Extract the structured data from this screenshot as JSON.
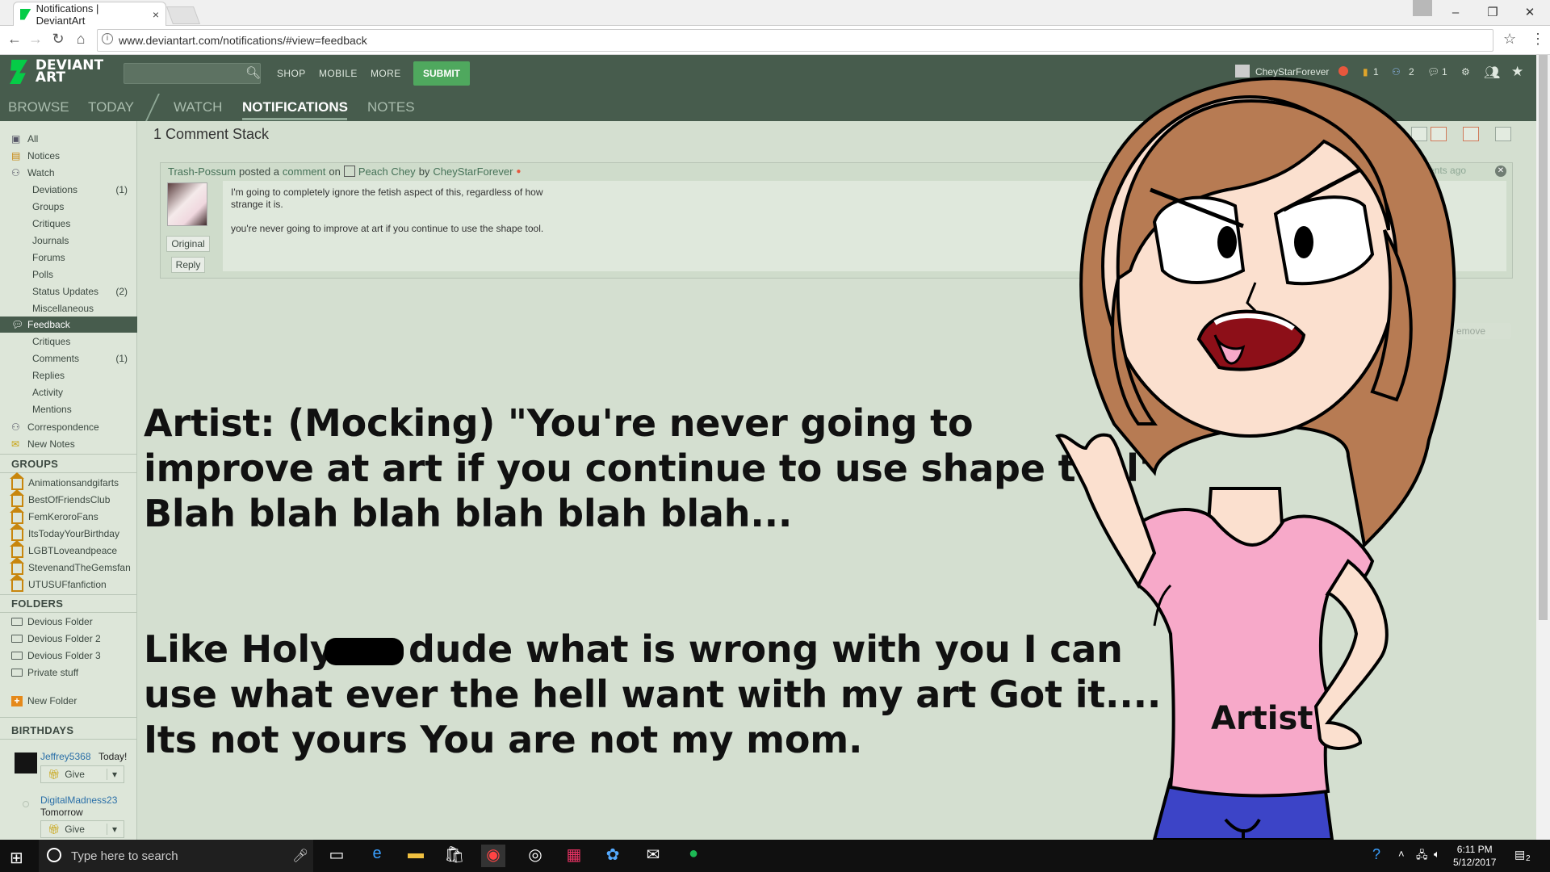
{
  "browser": {
    "tab_title": "Notifications | DeviantArt",
    "tab_close": "×",
    "url": "www.deviantart.com/notifications/#view=feedback",
    "window_controls": [
      "–",
      "❐",
      "✕"
    ],
    "nav_icons": [
      "back-icon",
      "forward-icon",
      "reload-icon",
      "home-icon"
    ]
  },
  "da_header": {
    "logo_line1": "DEVIANT",
    "logo_line2": "ART",
    "nav": [
      "SHOP",
      "MOBILE",
      "MORE"
    ],
    "submit_label": "SUBMIT",
    "username": "CheyStarForever",
    "counts": [
      "1",
      "2",
      "1"
    ]
  },
  "subnav": {
    "items": [
      "BROWSE",
      "TODAY",
      "WATCH",
      "NOTIFICATIONS",
      "NOTES"
    ],
    "active": "NOTIFICATIONS"
  },
  "sidebar": {
    "top": [
      {
        "label": "All",
        "icon": "all-icon"
      },
      {
        "label": "Notices",
        "icon": "notices-icon"
      },
      {
        "label": "Watch",
        "icon": "watch-icon"
      }
    ],
    "watch_sub": [
      {
        "label": "Deviations",
        "count": "(1)"
      },
      {
        "label": "Groups",
        "count": ""
      },
      {
        "label": "Critiques",
        "count": ""
      },
      {
        "label": "Journals",
        "count": ""
      },
      {
        "label": "Forums",
        "count": ""
      },
      {
        "label": "Polls",
        "count": ""
      },
      {
        "label": "Status Updates",
        "count": "(2)"
      },
      {
        "label": "Miscellaneous",
        "count": ""
      }
    ],
    "feedback": "Feedback",
    "feedback_sub": [
      {
        "label": "Critiques",
        "count": ""
      },
      {
        "label": "Comments",
        "count": "(1)"
      },
      {
        "label": "Replies",
        "count": ""
      },
      {
        "label": "Activity",
        "count": ""
      },
      {
        "label": "Mentions",
        "count": ""
      }
    ],
    "correspondence": "Correspondence",
    "new_notes": "New Notes",
    "groups_heading": "GROUPS",
    "groups": [
      "Animationsandgifarts",
      "BestOfFriendsClub",
      "FemKeroroFans",
      "ItsTodayYourBirthday",
      "LGBTLoveandpeace",
      "StevenandTheGemsfan",
      "UTUSUFfanfiction"
    ],
    "folders_heading": "FOLDERS",
    "folders": [
      "Devious Folder",
      "Devious Folder 2",
      "Devious Folder 3",
      "Private stuff"
    ],
    "new_folder": "New Folder",
    "birthdays_heading": "BIRTHDAYS",
    "birthdays": [
      {
        "name": "Jeffrey5368",
        "when": "Today!",
        "give": "Give"
      },
      {
        "name": "DigitalMadness23",
        "when": "Tomorrow",
        "give": "Give"
      }
    ]
  },
  "main": {
    "stack_title": "1 Comment Stack",
    "comment": {
      "author": "Trash-Possum",
      "posted_a": "posted a",
      "comment_link": "comment",
      "on": "on",
      "deviation": "Peach Chey",
      "by": "by",
      "owner": "CheyStarForever",
      "time": "ents ago",
      "text1": "I'm going to completely ignore the fetish aspect of this, regardless of how strange it is.",
      "text2": "you're never going to improve at art if you continue to use the shape tool.",
      "original_label": "Original",
      "reply_label": "Reply",
      "remove_label": "emove"
    }
  },
  "overlay": {
    "lines1": [
      "Artist: (Mocking) \"You're never going to",
      "improve at art if you continue to use shape tool\"",
      "Blah blah blah blah blah blah..."
    ],
    "line2a": "Like Holy",
    "line2b": "dude what is wrong with you I can",
    "lines2": [
      "use what ever the hell want with my art Got it....",
      "Its not yours You are not my mom."
    ],
    "shirt_label": "Artist"
  },
  "taskbar": {
    "search_placeholder": "Type here to search",
    "time": "6:11 PM",
    "date": "5/12/2017",
    "notif_count": "2"
  },
  "colors": {
    "da_green": "#475c4d",
    "accent": "#05cc47",
    "skin": "#fbe0cf",
    "hair": "#b77b53",
    "shirt": "#f7a9c9",
    "pants": "#3c44c7"
  }
}
